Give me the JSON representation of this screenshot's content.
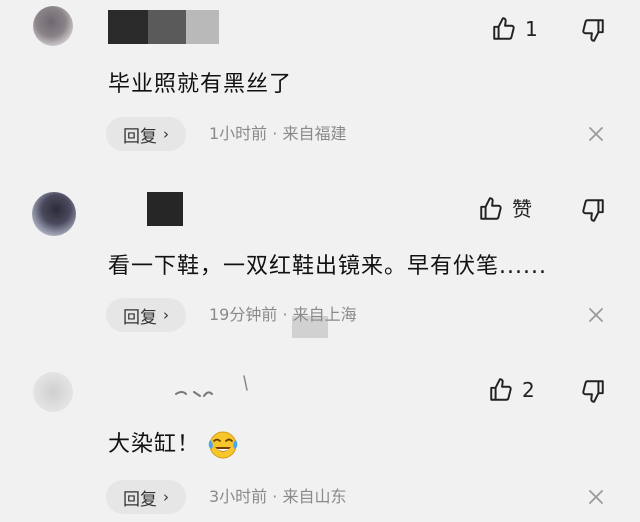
{
  "comments": [
    {
      "text": "毕业照就有黑丝了",
      "like_count": "1",
      "reply_label": "回复",
      "reply_chevron": "›",
      "meta": "1小时前 · 来自福建"
    },
    {
      "text": "看一下鞋，一双红鞋出镜来。早有伏笔......",
      "like_count": "赞",
      "reply_label": "回复",
      "reply_chevron": "›",
      "meta": "19分钟前 · 来自上海"
    },
    {
      "text": "大染缸！",
      "emoji": "tears-of-joy-emoji",
      "like_count": "2",
      "reply_label": "回复",
      "reply_chevron": "›",
      "meta": "3小时前 · 来自山东"
    }
  ],
  "icons": {
    "like": "thumbs-up-icon",
    "dislike": "thumbs-down-icon",
    "close": "close-icon"
  },
  "colors": {
    "background": "#f1f1f1",
    "reply_pill": "#e6e6e6",
    "meta_text": "#8a8a8a"
  }
}
